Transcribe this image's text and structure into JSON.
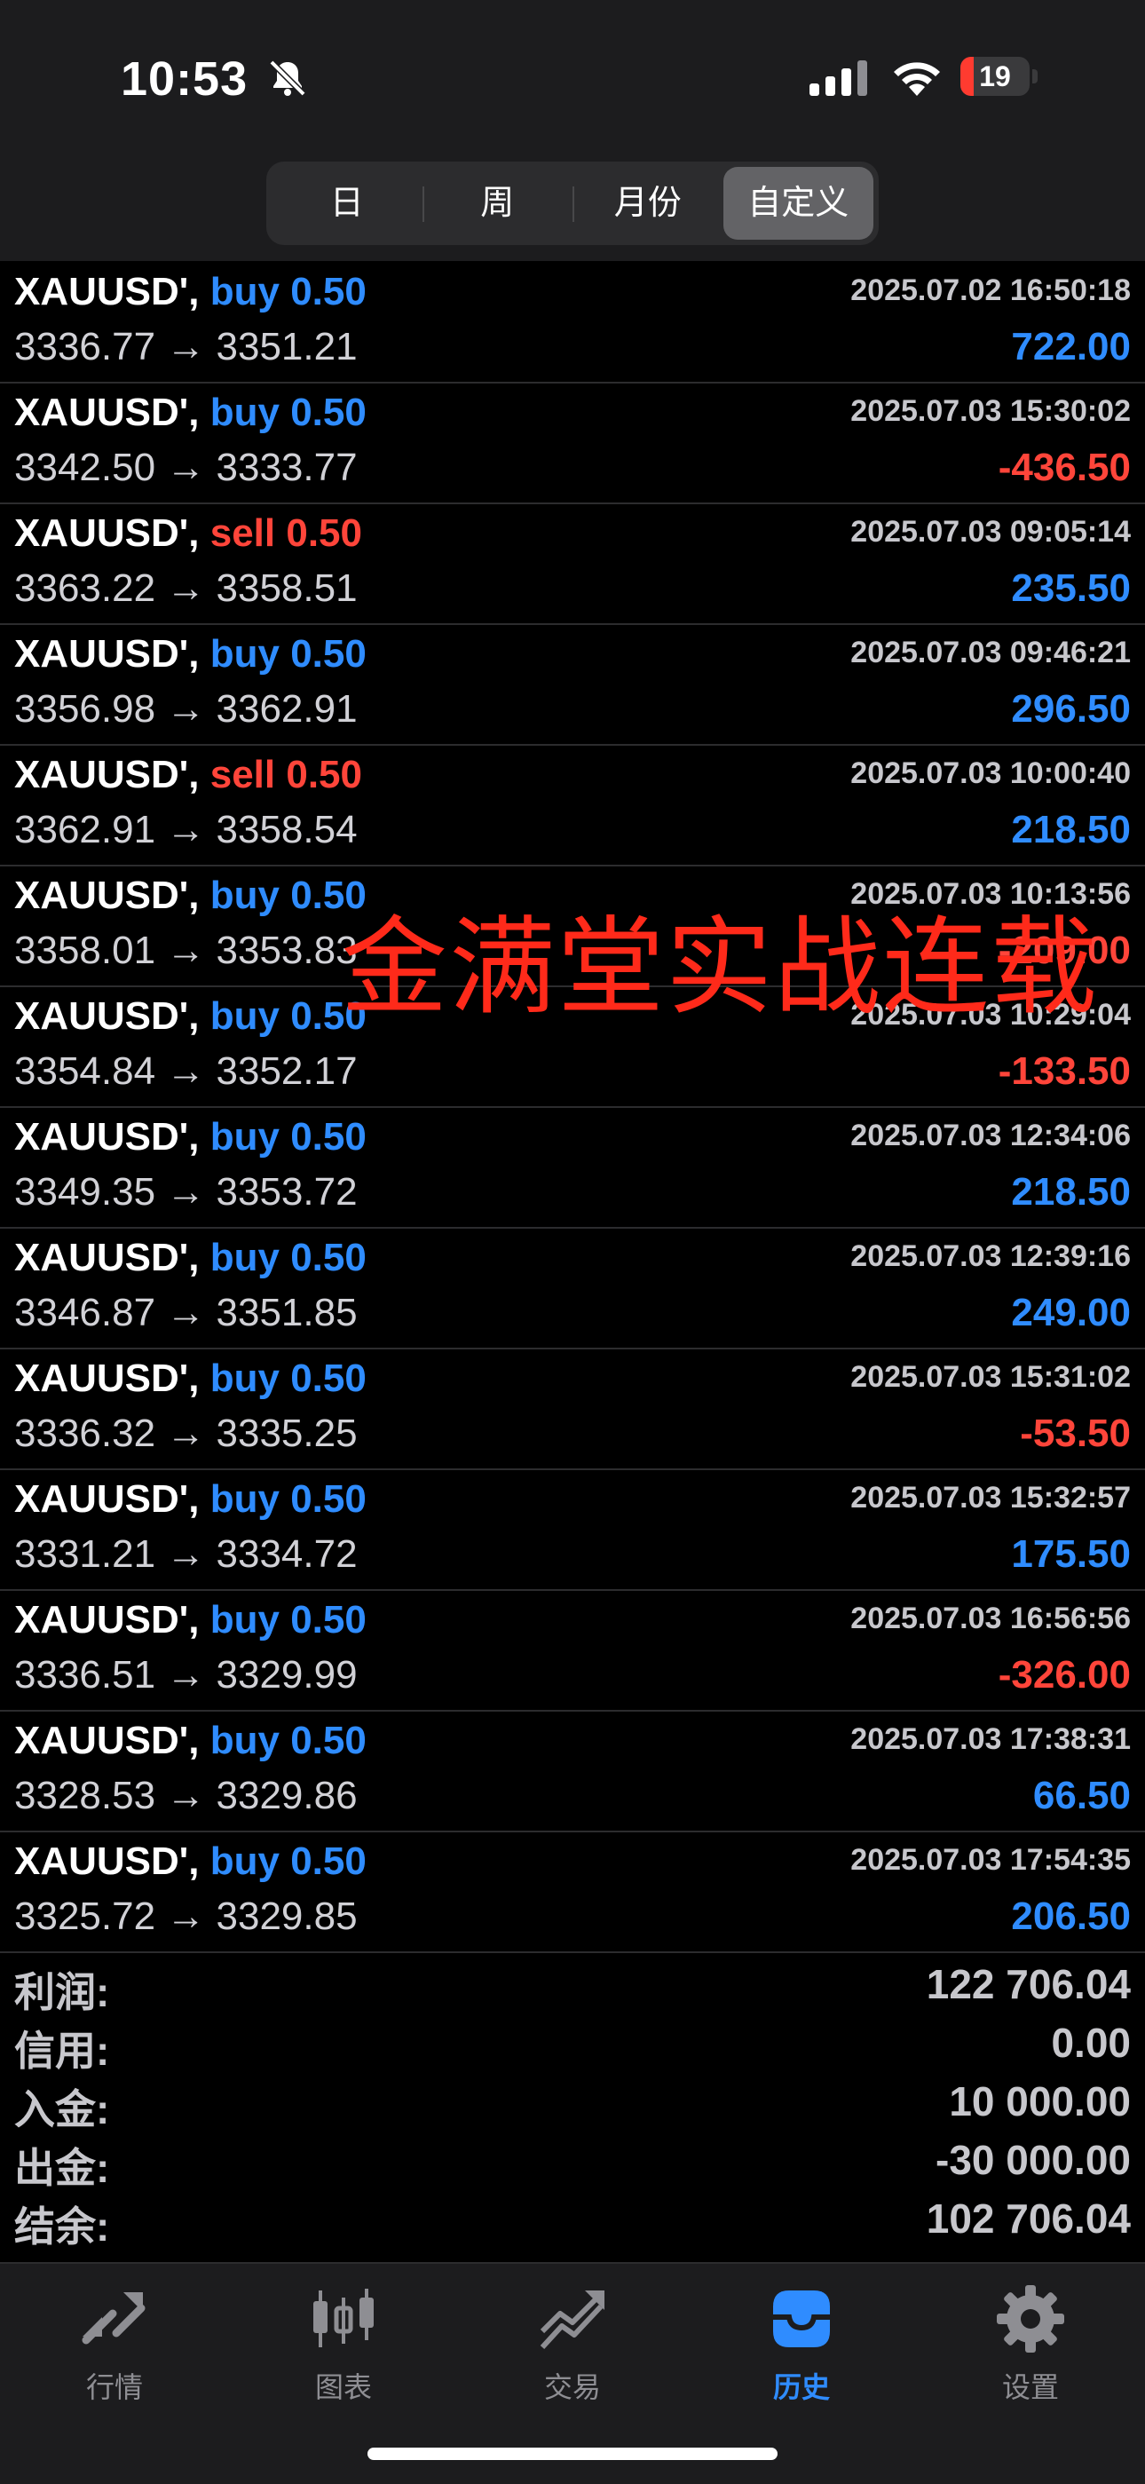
{
  "status_bar": {
    "time": "10:53",
    "battery_level": "19",
    "battery_fraction": 0.19,
    "battery_color": "#ff3b30"
  },
  "period_tabs": {
    "items": [
      "日",
      "周",
      "月份",
      "自定义"
    ],
    "active_index": 3
  },
  "deals": [
    {
      "symbol": "XAUUSD',",
      "side": "buy",
      "volume": "0.50",
      "datetime": "2025.07.02 16:50:18",
      "prices": "3336.77 → 3351.21",
      "profit": "722.00"
    },
    {
      "symbol": "XAUUSD',",
      "side": "buy",
      "volume": "0.50",
      "datetime": "2025.07.03 15:30:02",
      "prices": "3342.50 → 3333.77",
      "profit": "-436.50"
    },
    {
      "symbol": "XAUUSD',",
      "side": "sell",
      "volume": "0.50",
      "datetime": "2025.07.03 09:05:14",
      "prices": "3363.22 → 3358.51",
      "profit": "235.50"
    },
    {
      "symbol": "XAUUSD',",
      "side": "buy",
      "volume": "0.50",
      "datetime": "2025.07.03 09:46:21",
      "prices": "3356.98 → 3362.91",
      "profit": "296.50"
    },
    {
      "symbol": "XAUUSD',",
      "side": "sell",
      "volume": "0.50",
      "datetime": "2025.07.03 10:00:40",
      "prices": "3362.91 → 3358.54",
      "profit": "218.50"
    },
    {
      "symbol": "XAUUSD',",
      "side": "buy",
      "volume": "0.50",
      "datetime": "2025.07.03 10:13:56",
      "prices": "3358.01 → 3353.83",
      "profit": "-209.00"
    },
    {
      "symbol": "XAUUSD',",
      "side": "buy",
      "volume": "0.50",
      "datetime": "2025.07.03 10:29:04",
      "prices": "3354.84 → 3352.17",
      "profit": "-133.50"
    },
    {
      "symbol": "XAUUSD',",
      "side": "buy",
      "volume": "0.50",
      "datetime": "2025.07.03 12:34:06",
      "prices": "3349.35 → 3353.72",
      "profit": "218.50"
    },
    {
      "symbol": "XAUUSD',",
      "side": "buy",
      "volume": "0.50",
      "datetime": "2025.07.03 12:39:16",
      "prices": "3346.87 → 3351.85",
      "profit": "249.00"
    },
    {
      "symbol": "XAUUSD',",
      "side": "buy",
      "volume": "0.50",
      "datetime": "2025.07.03 15:31:02",
      "prices": "3336.32 → 3335.25",
      "profit": "-53.50"
    },
    {
      "symbol": "XAUUSD',",
      "side": "buy",
      "volume": "0.50",
      "datetime": "2025.07.03 15:32:57",
      "prices": "3331.21 → 3334.72",
      "profit": "175.50"
    },
    {
      "symbol": "XAUUSD',",
      "side": "buy",
      "volume": "0.50",
      "datetime": "2025.07.03 16:56:56",
      "prices": "3336.51 → 3329.99",
      "profit": "-326.00"
    },
    {
      "symbol": "XAUUSD',",
      "side": "buy",
      "volume": "0.50",
      "datetime": "2025.07.03 17:38:31",
      "prices": "3328.53 → 3329.86",
      "profit": "66.50"
    },
    {
      "symbol": "XAUUSD',",
      "side": "buy",
      "volume": "0.50",
      "datetime": "2025.07.03 17:54:35",
      "prices": "3325.72 → 3329.85",
      "profit": "206.50"
    }
  ],
  "watermark": "金满堂实战连载",
  "summary": [
    {
      "label": "利润:",
      "value": "122 706.04"
    },
    {
      "label": "信用:",
      "value": "0.00"
    },
    {
      "label": "入金:",
      "value": "10 000.00"
    },
    {
      "label": "出金:",
      "value": "-30 000.00"
    },
    {
      "label": "结余:",
      "value": "102 706.04"
    }
  ],
  "tabbar": {
    "items": [
      {
        "label": "行情",
        "icon": "quotes-icon"
      },
      {
        "label": "图表",
        "icon": "chart-icon"
      },
      {
        "label": "交易",
        "icon": "trade-icon"
      },
      {
        "label": "历史",
        "icon": "history-icon"
      },
      {
        "label": "设置",
        "icon": "settings-icon"
      }
    ],
    "active_index": 3
  },
  "colors": {
    "buy": "#2f8cff",
    "sell": "#ff453a",
    "profit_positive": "#2f8cff",
    "profit_negative": "#ff453a",
    "accent": "#2f8cff"
  }
}
